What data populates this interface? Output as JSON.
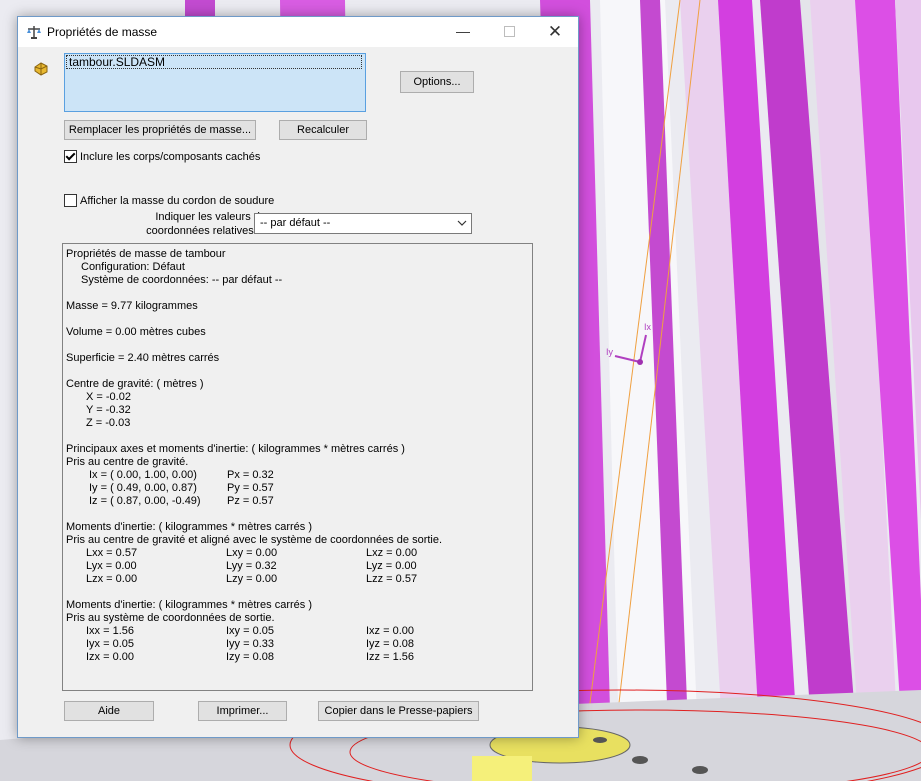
{
  "window": {
    "title": "Propriétés de masse",
    "close_glyph": "✕",
    "min_glyph": "—"
  },
  "file_list": {
    "items": [
      "tambour.SLDASM"
    ]
  },
  "buttons": {
    "options": "Options...",
    "replace": "Remplacer les propriétés de masse...",
    "recalc": "Recalculer",
    "help": "Aide",
    "print": "Imprimer...",
    "copy": "Copier dans le Presse-papiers"
  },
  "checkboxes": {
    "include_hidden": {
      "label": "Inclure les corps/composants cachés",
      "checked": true
    },
    "weld_bead": {
      "label": "Afficher la masse du cordon de soudure",
      "checked": false
    }
  },
  "coord_system": {
    "label_line1": "Indiquer les valeurs de",
    "label_line2": "coordonnées relatives à:",
    "selected": "-- par défaut --"
  },
  "results": {
    "heading": "Propriétés de masse de tambour",
    "configuration": "Configuration: Défaut",
    "coord_system": "Système de coordonnées: -- par défaut --",
    "mass": "Masse = 9.77 kilogrammes",
    "volume": "Volume = 0.00 mètres cubes",
    "surface": "Superficie = 2.40 mètres carrés",
    "cog_title": "Centre de gravité: ( mètres )",
    "cog": [
      "X = -0.02",
      "Y = -0.32",
      "Z = -0.03"
    ],
    "principal_title": "Principaux axes et moments d'inertie: ( kilogrammes * mètres carrés )",
    "principal_sub": "Pris au centre de gravité.",
    "principal_axes": [
      {
        "axis": "Ix = ( 0.00,  1.00,  0.00)",
        "moment": "Px = 0.32"
      },
      {
        "axis": "Iy = ( 0.49,  0.00,  0.87)",
        "moment": "Py = 0.57"
      },
      {
        "axis": "Iz = ( 0.87,  0.00, -0.49)",
        "moment": "Pz = 0.57"
      }
    ],
    "moments_cog_title": "Moments d'inertie: ( kilogrammes * mètres carrés )",
    "moments_cog_sub": "Pris au centre de gravité et aligné avec le système de coordonnées de sortie.",
    "moments_cog": [
      [
        "Lxx = 0.57",
        "Lxy = 0.00",
        "Lxz = 0.00"
      ],
      [
        "Lyx = 0.00",
        "Lyy = 0.32",
        "Lyz = 0.00"
      ],
      [
        "Lzx = 0.00",
        "Lzy = 0.00",
        "Lzz = 0.57"
      ]
    ],
    "moments_out_title": "Moments d'inertie: ( kilogrammes * mètres carrés )",
    "moments_out_sub": "Pris au système de coordonnées de sortie.",
    "moments_out": [
      [
        "Ixx = 1.56",
        "Ixy = 0.05",
        "Ixz = 0.00"
      ],
      [
        "Iyx = 0.05",
        "Iyy = 0.33",
        "Iyz = 0.08"
      ],
      [
        "Izx = 0.00",
        "Izy = 0.08",
        "Izz = 1.56"
      ]
    ]
  },
  "viewport": {
    "triad_labels": {
      "x": "Ix",
      "y": "Iy"
    },
    "colors": {
      "magenta": "#dc4fe6",
      "light_magenta": "#ead0ee",
      "sketch_red": "#e02020",
      "orange_line": "#f0a040"
    }
  }
}
